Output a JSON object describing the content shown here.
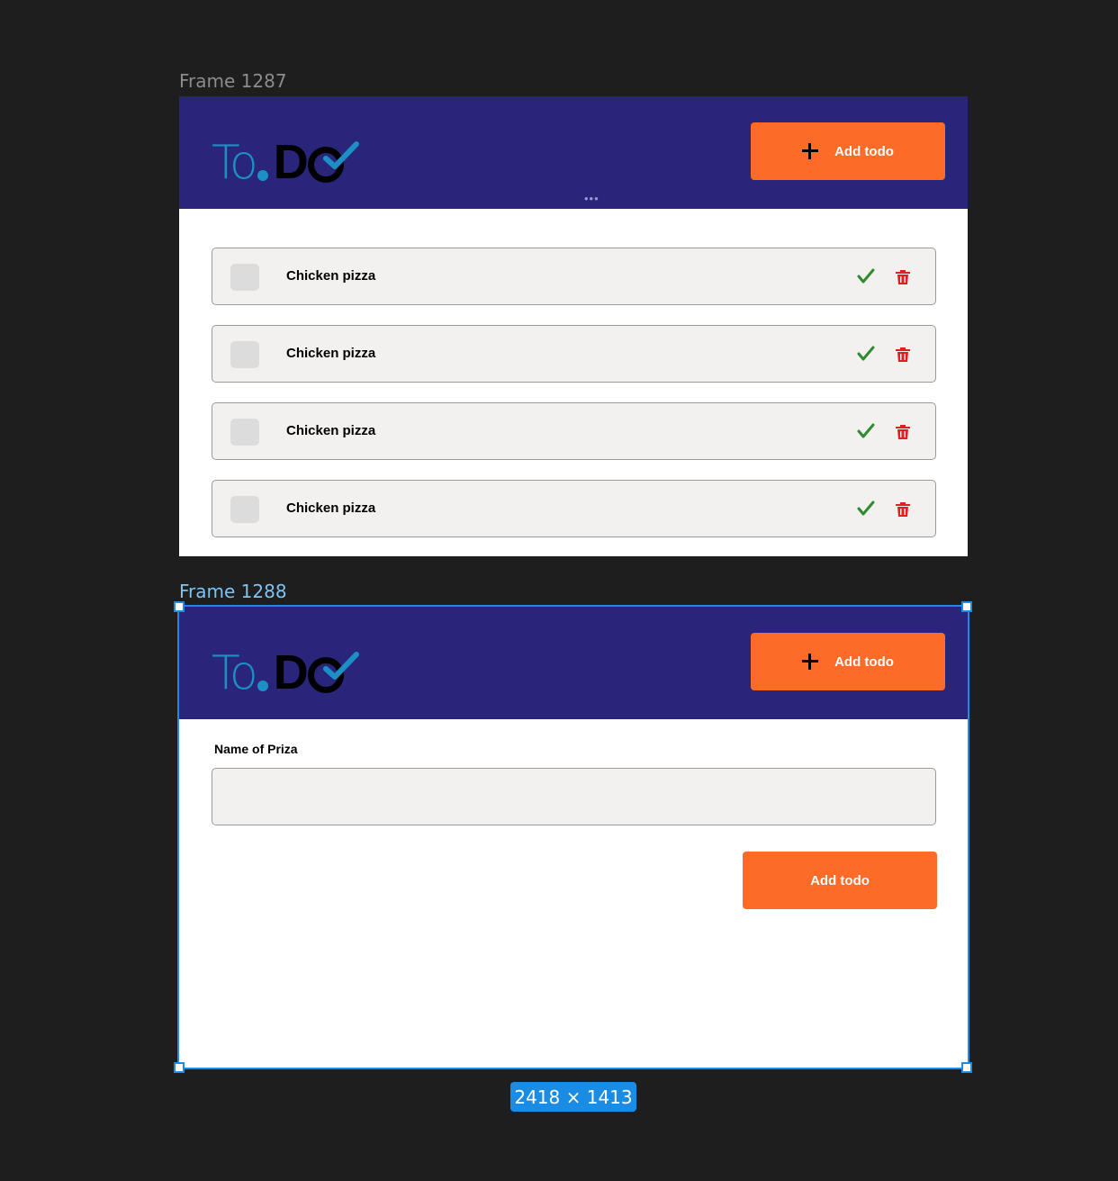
{
  "canvas": {
    "frame1_label": "Frame 1287",
    "frame2_label": "Frame 1288",
    "dimensions": "2418 × 1413"
  },
  "logo": {
    "part1": "To",
    "part2": "D"
  },
  "header": {
    "add_button_label": "Add  todo"
  },
  "todos": [
    {
      "label": "Chicken pizza"
    },
    {
      "label": "Chicken pizza"
    },
    {
      "label": "Chicken pizza"
    },
    {
      "label": "Chicken pizza"
    }
  ],
  "form": {
    "field_label": "Name of Priza",
    "field_value": "",
    "submit_label": "Add  todo"
  },
  "colors": {
    "header_bg": "#29257b",
    "accent": "#fd6b29",
    "done": "#2e8b2e",
    "delete": "#e0201c",
    "selection": "#1b8ce3"
  },
  "icons": [
    "plus-icon",
    "check-icon",
    "trash-icon"
  ]
}
